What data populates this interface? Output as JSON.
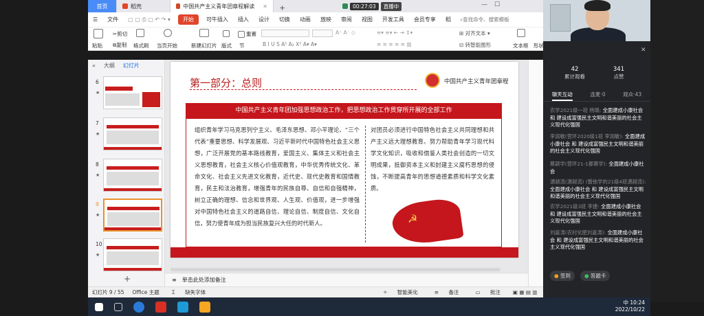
{
  "tabs": {
    "home": "首页",
    "docer": "稻壳",
    "active_doc": "中国共产主义青年团章程解读"
  },
  "recording": {
    "timer": "00:27:03",
    "live": "直播中"
  },
  "menu": {
    "file": "文件",
    "start": "开始",
    "items": [
      "可牛插入",
      "插入",
      "设计",
      "切换",
      "动画",
      "放映",
      "审阅",
      "视图",
      "开发工具",
      "会员专享",
      "稻"
    ],
    "search": "查找命令、搜索模板"
  },
  "ribbon": {
    "paste": "粘贴",
    "cut": "剪切",
    "copy": "复制",
    "format_painter": "格式刷",
    "from_current": "当页开始",
    "new_slide": "新建幻灯片",
    "layout": "版式",
    "section": "节",
    "reset": "重置",
    "align_text": "对齐文本",
    "convert_smartart": "转智能图形",
    "text_box": "文本框",
    "shape": "形状"
  },
  "left_pane": {
    "outline_tab": "大纲",
    "slides_tab": "幻灯片",
    "thumbs": [
      {
        "num": "6",
        "mark": "★"
      },
      {
        "num": "7",
        "mark": "★"
      },
      {
        "num": "8",
        "mark": "★"
      },
      {
        "num": "9",
        "mark": "★"
      },
      {
        "num": "10",
        "mark": "★"
      }
    ],
    "add": "+"
  },
  "slide": {
    "title": "第一部分：总则",
    "brand": "中国共产主义青年团章程",
    "banner": "中国共产主义青年团加强思想政治工作，把思想政治工作贯穿所开展的全部工作",
    "col1": "组织青年学习马克思列宁主义、毛泽东思想、邓小平理论、“三个代表”重要思想、科学发展观、习近平新时代中国特色社会主义思想，广泛开展党的基本路线教育，爱国主义、集体主义和社会主义思想教育，社会主义核心价值观教育，中华优秀传统文化、革命文化、社会主义先进文化教育，近代史、现代史教育和国情教育，民主和法治教育，增强青年的民族自尊、自信和自强精神，树立正确的理想、信念和世界观、人生观、价值观，进一步增强对中国特色社会主义的道路自信、理论自信、制度自信、文化自信，努力使青年成为担当民族复兴大任的时代新人。",
    "col2": "对团员必须进行中国特色社会主义共同理想和共产主义远大理想教育。努力帮助青年学习现代科学文化知识，吸收和借鉴人类社会创造的一切文明成果，抵御资本主义和封建主义腐朽思想的侵蚀，不断提高青年的思想道德素质和科学文化素质。"
  },
  "notes": {
    "placeholder": "单击此处添加备注"
  },
  "status": {
    "slide_count": "幻灯片 9 / 55",
    "theme": "Office 主题",
    "missing_fonts": "缺失字体",
    "smart_beautify": "智能美化",
    "notes_btn": "备注",
    "comments_btn": "批注"
  },
  "chat": {
    "views_num": "42",
    "views_label": "累计观看",
    "likes_num": "341",
    "likes_label": "点赞",
    "tab_chat": "聊天互动",
    "tab_qa": "连麦·0",
    "tab_viewers": "观众·43",
    "messages": [
      {
        "who": "农学2021级一班 杨璐:",
        "text": "全面建成小康社会 和 建设成富强民主文明和谐美丽的社会主义现代化强国"
      },
      {
        "who": "李润敏(营环2020级1班 李润敏):",
        "text": "全面建成小康社会 和 建设成富强民主文明和谐美丽的社会主义现代化强国"
      },
      {
        "who": "蔡颖学(营环21-1都蔡学):",
        "text": "全面建成小康社会"
      },
      {
        "who": "濃越流(濃越流) (暨他学的21级4班濃越流):",
        "text": "全面建成小康社会 和 建设成富强民主文明和谐美丽的社会主义现代化强国"
      },
      {
        "who": "农学2021级3班 李捷:",
        "text": "全面建成小康社会 和 建设成富强民主文明和谐美丽的社会主义现代化强国"
      },
      {
        "who": "刘嘉涛(农村化肥刘嘉涛):",
        "text": "全面建成小康社会 和 建设成富强民主文明和谐美丽的社会主义现代化强国"
      }
    ],
    "sign_in": "签到",
    "answer_card": "答题卡"
  },
  "taskbar": {
    "time": "10:24",
    "date": "2022/10/22",
    "ime": "中"
  },
  "colors": {
    "brand_red": "#c4161c",
    "title_red": "#b71c1c",
    "start_orange": "#e0452c",
    "selected_thumb": "#e8912c"
  }
}
